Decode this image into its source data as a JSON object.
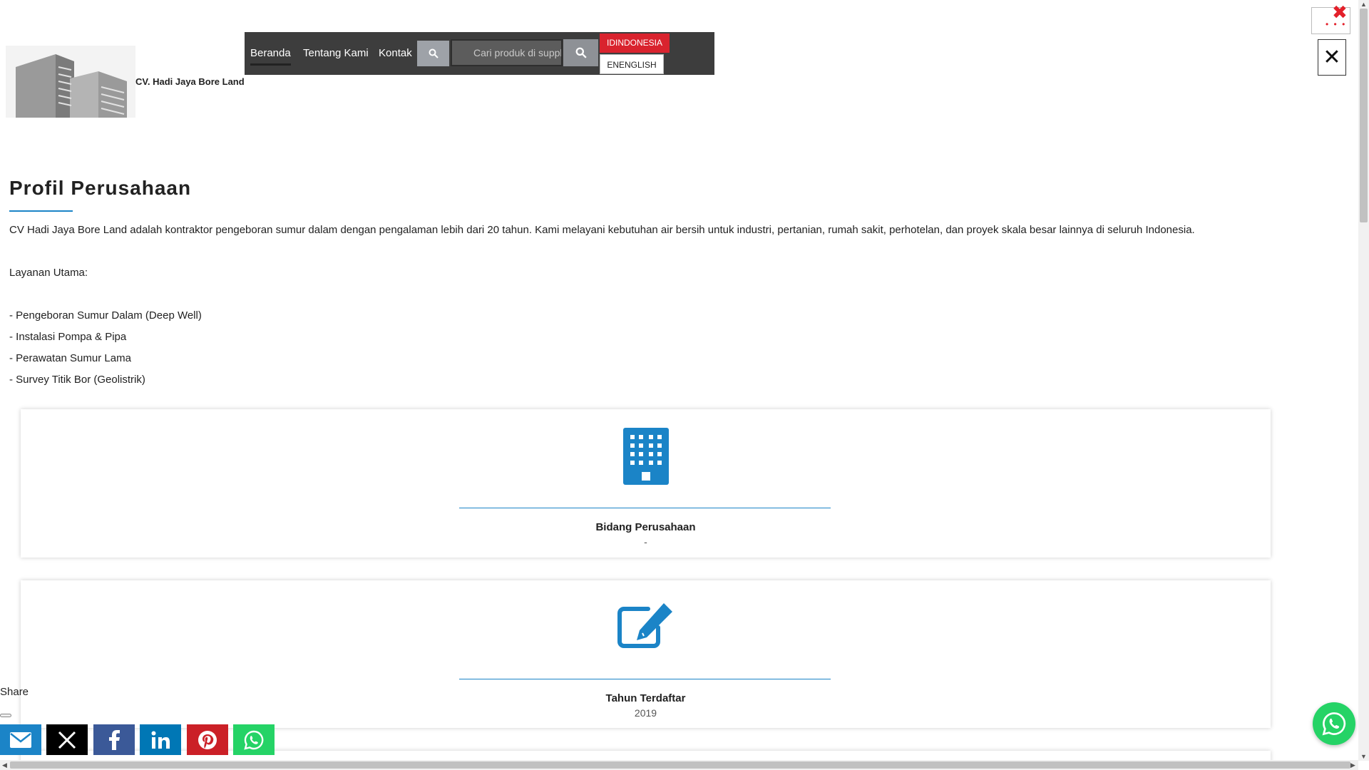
{
  "header": {
    "company_name": "CV. Hadi Jaya Bore Land",
    "nav": [
      {
        "label": "Beranda"
      },
      {
        "label": "Tentang Kami"
      },
      {
        "label": "Kontak"
      }
    ],
    "search": {
      "placeholder": "Cari produk di supplier ini",
      "value": ""
    },
    "languages": {
      "id": "IDINDONESIA",
      "en": "ENENGLISH"
    }
  },
  "page": {
    "title": "Profil Perusahaan",
    "intro": "CV Hadi Jaya Bore Land adalah kontraktor pengeboran sumur dalam dengan pengalaman lebih dari 20 tahun. Kami melayani kebutuhan air bersih untuk industri, pertanian, rumah sakit, perhotelan, dan proyek skala besar lainnya di seluruh Indonesia.",
    "services_heading": "Layanan Utama:",
    "services": [
      "- Pengeboran Sumur Dalam (Deep Well)",
      "- Instalasi Pompa & Pipa",
      "- Perawatan Sumur Lama",
      "- Survey Titik Bor (Geolistrik)"
    ]
  },
  "cards": [
    {
      "label": "Bidang Perusahaan",
      "value": "-",
      "icon": "building-icon"
    },
    {
      "label": "Tahun Terdaftar",
      "value": "2019",
      "icon": "edit-icon"
    }
  ],
  "share": {
    "label": "Share",
    "buttons": [
      {
        "icon": "email-icon",
        "color": "#1b84c7"
      },
      {
        "icon": "x-icon",
        "color": "#000000"
      },
      {
        "icon": "facebook-icon",
        "color": "#3b5998"
      },
      {
        "icon": "linkedin-icon",
        "color": "#0077b5"
      },
      {
        "icon": "pinterest-icon",
        "color": "#cb2027"
      },
      {
        "icon": "whatsapp-icon",
        "color": "#25d366"
      }
    ]
  },
  "colors": {
    "accent": "#1b84c7",
    "nav_bg": "#3d3d3d",
    "lang_active": "#d9232e",
    "whatsapp": "#25d366"
  }
}
